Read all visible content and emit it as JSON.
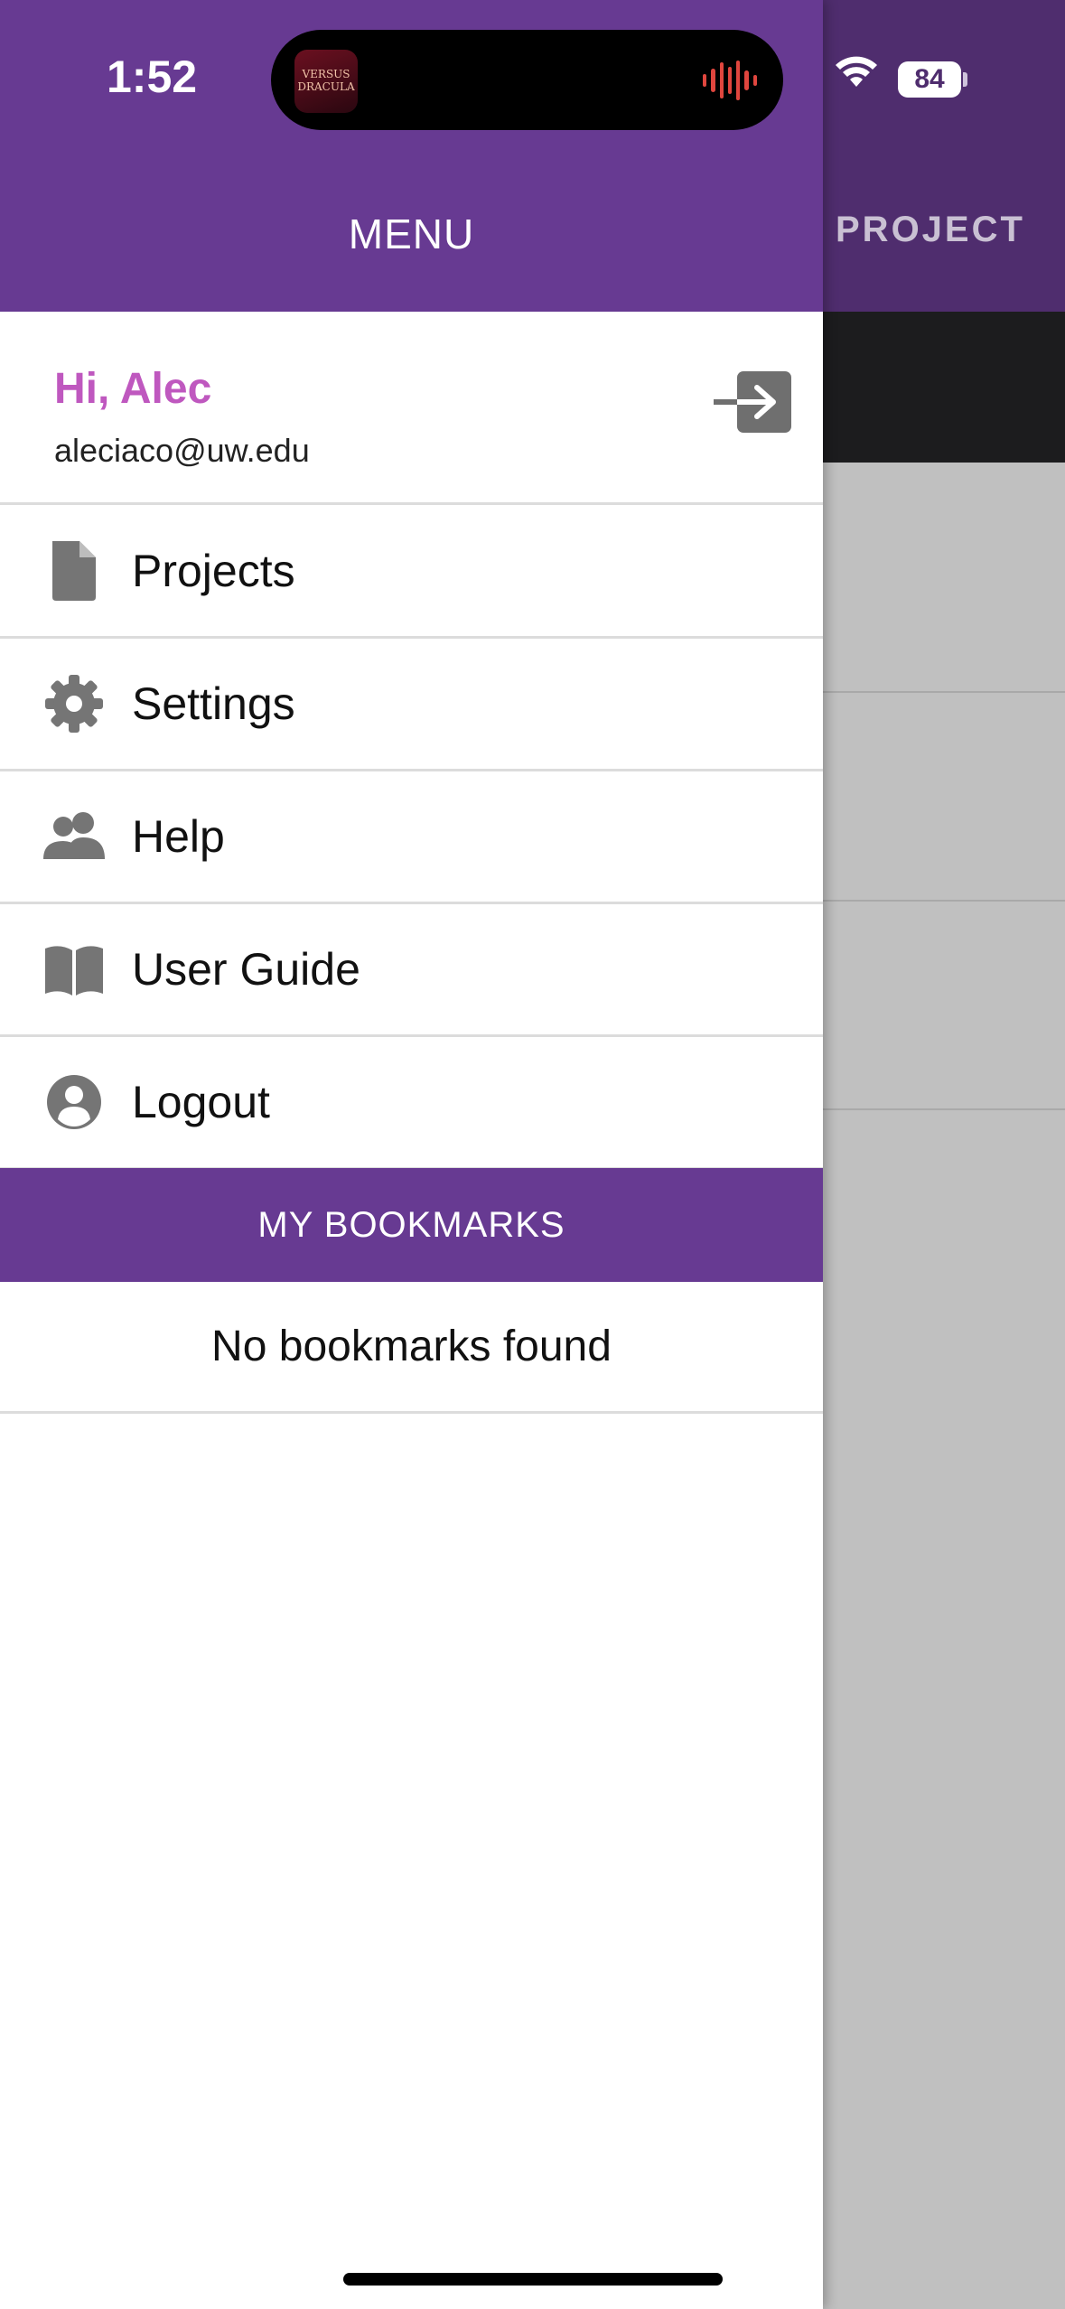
{
  "status_bar": {
    "time": "1:52",
    "battery": "84",
    "now_playing_thumb": "VERSUS DRACULA"
  },
  "background_screen": {
    "title": "PROJECT"
  },
  "drawer": {
    "title": "MENU",
    "greeting": "Hi, Alec",
    "email": "aleciaco@uw.edu",
    "items": [
      {
        "label": "Projects",
        "icon": "document-icon"
      },
      {
        "label": "Settings",
        "icon": "gear-icon"
      },
      {
        "label": "Help",
        "icon": "people-icon"
      },
      {
        "label": "User Guide",
        "icon": "book-icon"
      },
      {
        "label": "Logout",
        "icon": "user-circle-icon"
      }
    ],
    "bookmarks_header": "MY BOOKMARKS",
    "bookmarks_empty": "No bookmarks found"
  },
  "colors": {
    "drawer_purple": "#673a92",
    "greeting_pink": "#bf58bf",
    "icon_gray": "#757575"
  }
}
